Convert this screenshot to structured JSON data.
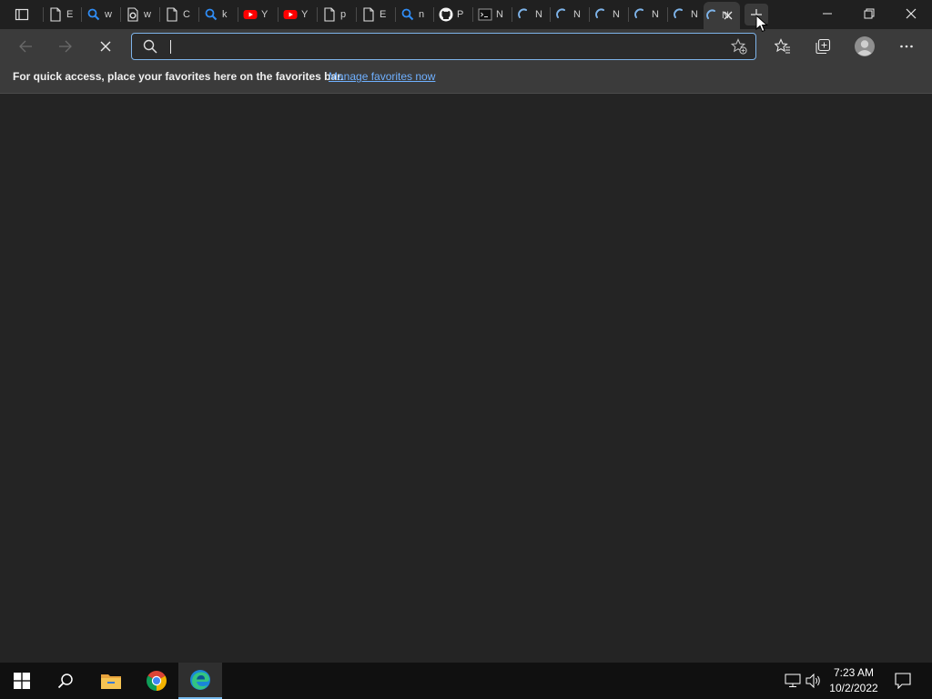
{
  "browser": {
    "tabs": [
      {
        "title": "E",
        "icon": "page-icon"
      },
      {
        "title": "w",
        "icon": "search-icon"
      },
      {
        "title": "w",
        "icon": "settings-page-icon"
      },
      {
        "title": "C",
        "icon": "page-icon"
      },
      {
        "title": "k",
        "icon": "search-icon"
      },
      {
        "title": "Y",
        "icon": "youtube-icon"
      },
      {
        "title": "Y",
        "icon": "youtube-icon"
      },
      {
        "title": "p",
        "icon": "page-icon"
      },
      {
        "title": "E",
        "icon": "page-icon"
      },
      {
        "title": "n",
        "icon": "search-icon"
      },
      {
        "title": "P",
        "icon": "github-icon"
      },
      {
        "title": "N",
        "icon": "terminal-icon"
      },
      {
        "title": "N",
        "icon": "loading-icon"
      },
      {
        "title": "N",
        "icon": "loading-icon"
      },
      {
        "title": "N",
        "icon": "loading-icon"
      },
      {
        "title": "N",
        "icon": "loading-icon"
      },
      {
        "title": "N",
        "icon": "loading-icon"
      },
      {
        "title": "N",
        "icon": "loading-icon",
        "active": true
      }
    ],
    "address": {
      "value": "",
      "placeholder": ""
    },
    "favorites_bar": {
      "message": "For quick access, place your favorites here on the favorites bar.",
      "link": "Manage favorites now"
    },
    "colors": {
      "accent": "#7eb4ea",
      "link": "#6fb0ff",
      "background": "#242424"
    }
  },
  "taskbar": {
    "apps": [
      "start-icon",
      "search-icon",
      "file-explorer-icon",
      "chrome-icon",
      "edge-icon"
    ],
    "active_app": "edge-icon",
    "clock": {
      "time": "7:23 AM",
      "date": "10/2/2022"
    }
  }
}
